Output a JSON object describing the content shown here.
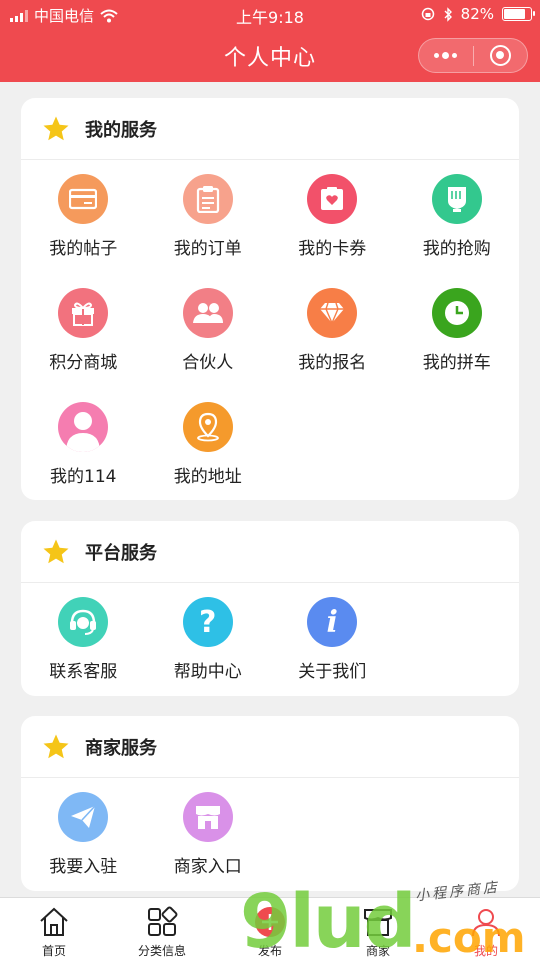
{
  "status_bar": {
    "carrier": "中国电信",
    "time": "上午9:18",
    "battery": "82%",
    "battery_level": 0.82
  },
  "nav": {
    "title": "个人中心"
  },
  "sections": [
    {
      "title": "我的服务",
      "items": [
        {
          "label": "我的帖子",
          "icon": "card-icon",
          "color": "#f59a5c"
        },
        {
          "label": "我的订单",
          "icon": "clipboard-icon",
          "color": "#f7a28c"
        },
        {
          "label": "我的卡券",
          "icon": "coupon-icon",
          "color": "#f2516a"
        },
        {
          "label": "我的抢购",
          "icon": "shopping-bag-icon",
          "color": "#33c88e"
        },
        {
          "label": "积分商城",
          "icon": "gift-icon",
          "color": "#f2727e"
        },
        {
          "label": "合伙人",
          "icon": "partners-icon",
          "color": "#f27f86"
        },
        {
          "label": "我的报名",
          "icon": "diamond-icon",
          "color": "#f77e47"
        },
        {
          "label": "我的拼车",
          "icon": "clock-icon",
          "color": "#3aa51e"
        },
        {
          "label": "我的114",
          "icon": "user-icon",
          "color": "#f57db0"
        },
        {
          "label": "我的地址",
          "icon": "location-icon",
          "color": "#f59a2c"
        }
      ]
    },
    {
      "title": "平台服务",
      "items": [
        {
          "label": "联系客服",
          "icon": "headset-icon",
          "color": "#41d2b8"
        },
        {
          "label": "帮助中心",
          "icon": "question-icon",
          "color": "#2ec0e6"
        },
        {
          "label": "关于我们",
          "icon": "info-icon",
          "color": "#5a8bf0"
        }
      ]
    },
    {
      "title": "商家服务",
      "items": [
        {
          "label": "我要入驻",
          "icon": "paper-plane-icon",
          "color": "#7fb8f5"
        },
        {
          "label": "商家入口",
          "icon": "store-icon",
          "color": "#d991e8"
        }
      ]
    }
  ],
  "tab_bar": [
    {
      "label": "首页",
      "icon": "home-icon"
    },
    {
      "label": "分类信息",
      "icon": "category-icon"
    },
    {
      "label": "发布",
      "icon": "publish-icon"
    },
    {
      "label": "商家",
      "icon": "store-icon"
    },
    {
      "label": "我的",
      "icon": "profile-icon",
      "active": true
    }
  ],
  "watermark": {
    "big": "9lud",
    "com": ".com",
    "small": "小程序商店"
  },
  "colors": {
    "brand_red": "#ef4a4f",
    "star_yellow": "#f5c518",
    "background": "#f0f0f0"
  }
}
